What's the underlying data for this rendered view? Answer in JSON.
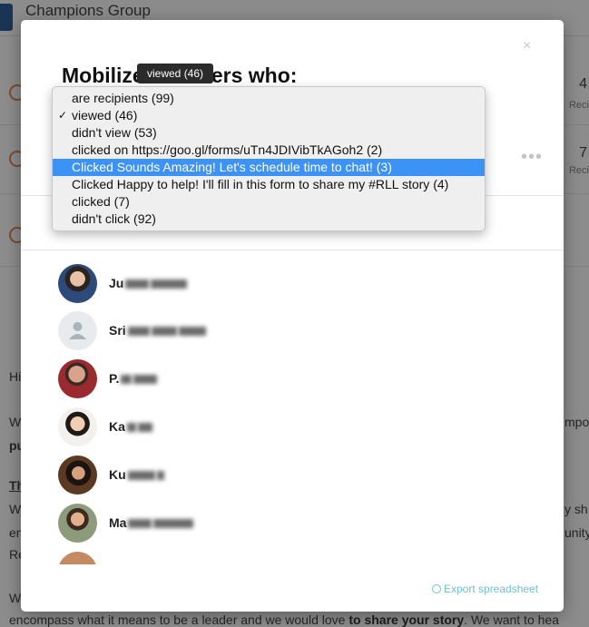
{
  "background": {
    "app_title": "Champions Group",
    "row_numbers": [
      "4",
      "7"
    ],
    "row_sub": [
      "Reci",
      "Reci"
    ],
    "text_lines": [
      "Hi",
      "W",
      "pu",
      "Th",
      "W",
      "en",
      "Re",
      "W"
    ],
    "text_right": [
      "mpo",
      "y sh",
      "unity"
    ],
    "last_line_pre": "encompass what it means to be a leader and we would love ",
    "last_line_bold": "to share your story",
    "last_line_post": ".  We want to hea"
  },
  "modal": {
    "title": "Mobilize members who:",
    "close_icon": "×",
    "more_icon": "•••",
    "tooltip": "viewed (46)",
    "export_label": "Export spreadsheet"
  },
  "dropdown": {
    "selected": "viewed (46)",
    "highlighted": "Clicked Sounds Amazing! Let's schedule time to chat! (3)",
    "options": [
      {
        "label": "are recipients (99)",
        "checked": false,
        "highlighted": false
      },
      {
        "label": "viewed (46)",
        "checked": true,
        "highlighted": false
      },
      {
        "label": "didn't view (53)",
        "checked": false,
        "highlighted": false
      },
      {
        "label": "clicked on https://goo.gl/forms/uTn4JDIVibTkAGoh2 (2)",
        "checked": false,
        "highlighted": false
      },
      {
        "label": "Clicked Sounds Amazing! Let's schedule time to chat! (3)",
        "checked": false,
        "highlighted": true
      },
      {
        "label": "Clicked Happy to help! I'll fill in this form to share my #RLL story (4)",
        "checked": false,
        "highlighted": false
      },
      {
        "label": "clicked (7)",
        "checked": false,
        "highlighted": false
      },
      {
        "label": "didn't click (92)",
        "checked": false,
        "highlighted": false
      }
    ]
  },
  "members": [
    {
      "name_visible": "Ju",
      "avatar": "photo"
    },
    {
      "name_visible": "Sri",
      "avatar": "placeholder-person-icon"
    },
    {
      "name_visible": "P.",
      "avatar": "photo"
    },
    {
      "name_visible": "Ka",
      "avatar": "photo"
    },
    {
      "name_visible": "Ku",
      "avatar": "photo"
    },
    {
      "name_visible": "Ma",
      "avatar": "photo"
    },
    {
      "name_visible": "",
      "avatar": "photo"
    }
  ],
  "colors": {
    "highlight": "#3d92f5",
    "export_link": "#6fc1cf",
    "tooltip_bg": "#2b2b2b"
  }
}
